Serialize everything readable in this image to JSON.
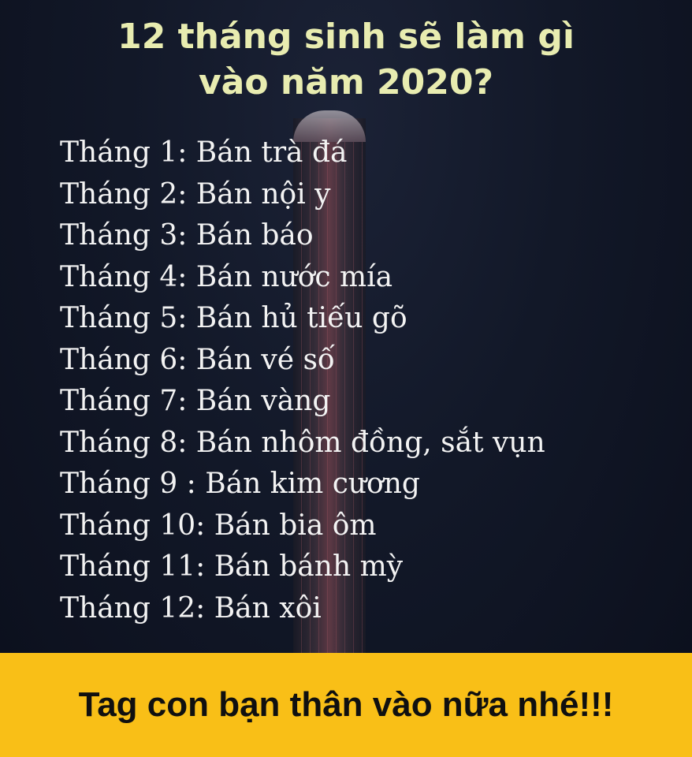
{
  "title_line1": "12 tháng sinh sẽ làm gì",
  "title_line2": "vào năm 2020?",
  "months": [
    "Tháng 1: Bán trà đá",
    "Tháng 2: Bán nội y",
    "Tháng 3: Bán báo",
    "Tháng 4: Bán nước mía",
    "Tháng 5: Bán hủ tiếu gõ",
    "Tháng 6: Bán vé số",
    "Tháng 7: Bán vàng",
    "Tháng 8: Bán nhôm đồng, sắt vụn",
    "Tháng 9 : Bán kim cương",
    "Tháng 10: Bán bia ôm",
    "Tháng 11: Bán bánh mỳ",
    "Tháng 12: Bán xôi"
  ],
  "footer": "Tag con bạn thân vào nữa nhé!!!",
  "colors": {
    "title": "#e8ecb0",
    "text": "#f3f3f3",
    "footer_bg": "#f9bf17",
    "footer_text": "#101010"
  }
}
